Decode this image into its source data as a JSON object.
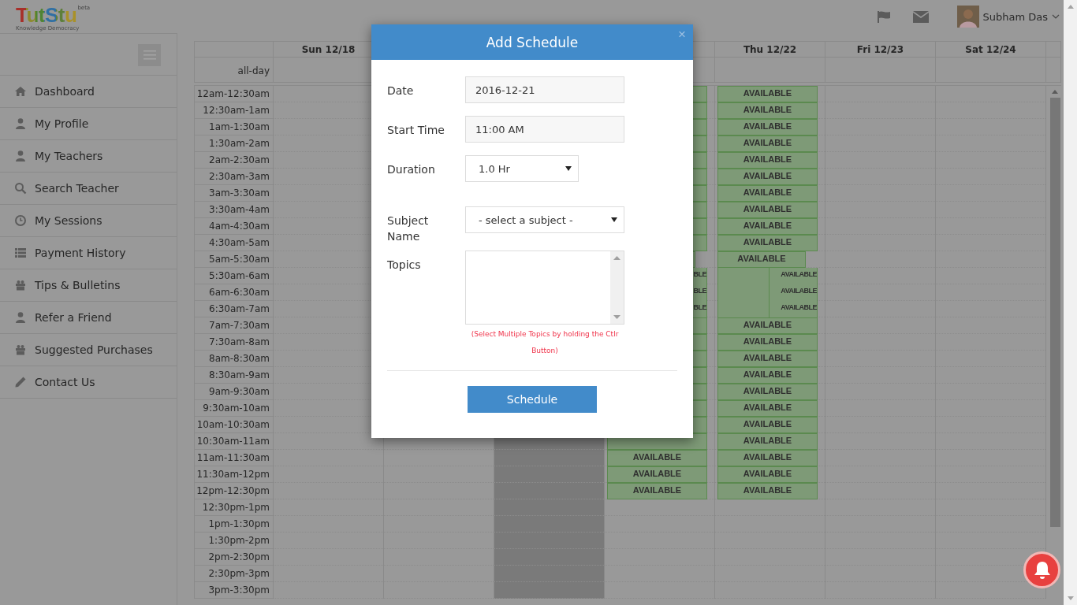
{
  "header": {
    "logo": "TutStu",
    "logo_badge": "beta",
    "tagline": "Knowledge Democracy",
    "user_name": "Subham Das"
  },
  "sidebar": {
    "items": [
      {
        "label": "Dashboard",
        "kind": "home"
      },
      {
        "label": "My Profile",
        "kind": "user"
      },
      {
        "label": "My Teachers",
        "kind": "user"
      },
      {
        "label": "Search Teacher",
        "kind": "search"
      },
      {
        "label": "My Sessions",
        "kind": "clock"
      },
      {
        "label": "Payment History",
        "kind": "list"
      },
      {
        "label": "Tips & Bulletins",
        "kind": "gift"
      },
      {
        "label": "Refer a Friend",
        "kind": "user"
      },
      {
        "label": "Suggested Purchases",
        "kind": "gift"
      },
      {
        "label": "Contact Us",
        "kind": "pencil"
      }
    ]
  },
  "calendar": {
    "all_day_label": "all-day",
    "times": [
      "12am-12:30am",
      "12:30am-1am",
      "1am-1:30am",
      "1:30am-2am",
      "2am-2:30am",
      "2:30am-3am",
      "3am-3:30am",
      "3:30am-4am",
      "4am-4:30am",
      "4:30am-5am",
      "5am-5:30am",
      "5:30am-6am",
      "6am-6:30am",
      "6:30am-7am",
      "7am-7:30am",
      "7:30am-8am",
      "8am-8:30am",
      "8:30am-9am",
      "9am-9:30am",
      "9:30am-10am",
      "10am-10:30am",
      "10:30am-11am",
      "11am-11:30am",
      "11:30am-12pm",
      "12pm-12:30pm",
      "12:30pm-1pm",
      "1pm-1:30pm",
      "1:30pm-2pm",
      "2pm-2:30pm",
      "2:30pm-3pm",
      "3pm-3:30pm"
    ],
    "days": [
      {
        "label": "Sun 12/18",
        "today": false
      },
      {
        "today": false
      },
      {
        "today": true
      },
      {
        "today": false,
        "slots": [
          {
            "kind": "full"
          },
          {
            "kind": "full"
          },
          {
            "kind": "full"
          },
          {
            "kind": "full"
          },
          {
            "kind": "full"
          },
          {
            "kind": "full"
          },
          {
            "kind": "full"
          },
          {
            "kind": "full"
          },
          {
            "kind": "full"
          },
          {
            "kind": "full"
          },
          {
            "kind": "narrow"
          },
          {
            "kind": "split",
            "text": "BLE"
          },
          {
            "kind": "split",
            "text": "BLE"
          },
          {
            "kind": "split",
            "text": "BLE"
          },
          {
            "kind": "full"
          },
          {
            "kind": "full"
          },
          {
            "kind": "full"
          },
          {
            "kind": "full"
          },
          {
            "kind": "full"
          },
          {
            "kind": "full"
          },
          {
            "kind": "full"
          },
          {
            "kind": "full"
          },
          {
            "kind": "full",
            "text": "AVAILABLE"
          },
          {
            "kind": "full",
            "text": "AVAILABLE"
          },
          {
            "kind": "full",
            "text": "AVAILABLE"
          }
        ]
      },
      {
        "label": "Thu 12/22",
        "today": false,
        "slots": [
          {
            "kind": "full",
            "text": "AVAILABLE"
          },
          {
            "kind": "full",
            "text": "AVAILABLE"
          },
          {
            "kind": "full",
            "text": "AVAILABLE"
          },
          {
            "kind": "full",
            "text": "AVAILABLE"
          },
          {
            "kind": "full",
            "text": "AVAILABLE"
          },
          {
            "kind": "full",
            "text": "AVAILABLE"
          },
          {
            "kind": "full",
            "text": "AVAILABLE"
          },
          {
            "kind": "full",
            "text": "AVAILABLE"
          },
          {
            "kind": "full",
            "text": "AVAILABLE"
          },
          {
            "kind": "full",
            "text": "AVAILABLE"
          },
          {
            "kind": "narrow",
            "text": "AVAILABLE"
          },
          {
            "kind": "split",
            "text": "AVAILABLE"
          },
          {
            "kind": "split",
            "text": "AVAILABLE"
          },
          {
            "kind": "split",
            "text": "AVAILABLE"
          },
          {
            "kind": "full",
            "text": "AVAILABLE"
          },
          {
            "kind": "full",
            "text": "AVAILABLE"
          },
          {
            "kind": "full",
            "text": "AVAILABLE"
          },
          {
            "kind": "full",
            "text": "AVAILABLE"
          },
          {
            "kind": "full",
            "text": "AVAILABLE"
          },
          {
            "kind": "full",
            "text": "AVAILABLE"
          },
          {
            "kind": "full",
            "text": "AVAILABLE"
          },
          {
            "kind": "full",
            "text": "AVAILABLE"
          },
          {
            "kind": "full",
            "text": "AVAILABLE"
          },
          {
            "kind": "full",
            "text": "AVAILABLE"
          },
          {
            "kind": "full",
            "text": "AVAILABLE"
          }
        ]
      },
      {
        "label": "Fri 12/23",
        "today": false
      },
      {
        "label": "Sat 12/24",
        "today": false
      }
    ]
  },
  "modal": {
    "title": "Add Schedule",
    "close": "×",
    "fields": [
      {
        "label": "Date",
        "kind": "text",
        "value": "2016-12-21"
      },
      {
        "label": "Start Time",
        "kind": "text",
        "value": "11:00 AM"
      },
      {
        "label": "Duration",
        "kind": "select",
        "wide": false,
        "value": "1.0 Hr"
      },
      {
        "label": "Subject Name",
        "kind": "select",
        "wide": true,
        "value": "- select a subject -"
      },
      {
        "label": "Topics",
        "kind": "multiselect",
        "hint": "(Select Multiple Topics by holding the Ctlr Button)"
      }
    ],
    "button": "Schedule"
  }
}
